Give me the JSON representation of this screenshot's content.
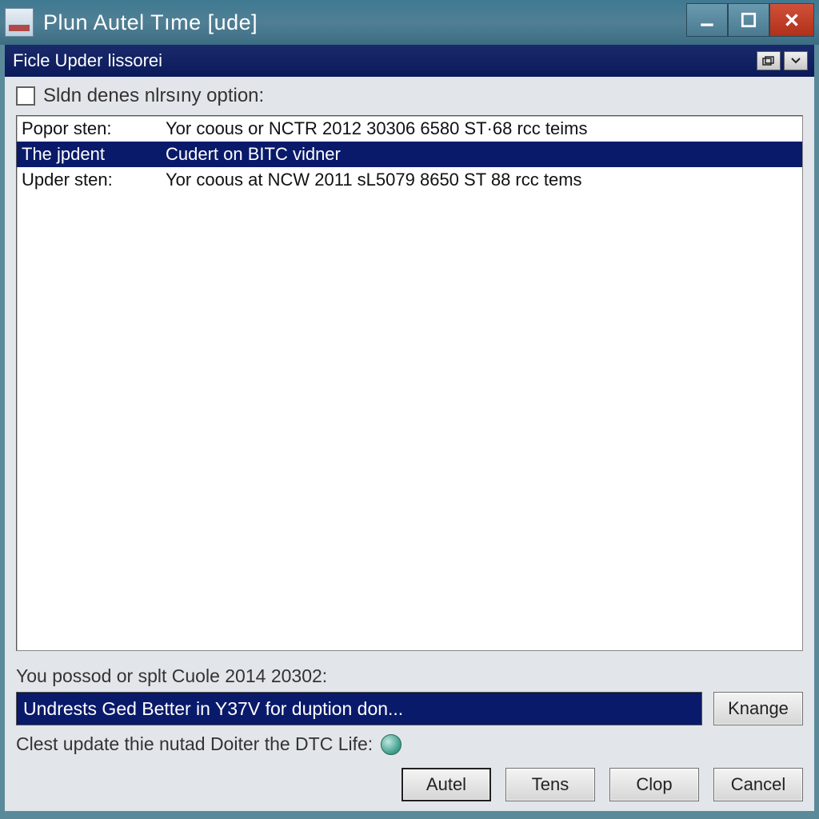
{
  "window": {
    "title": "Plun Autel Tıme [ude]"
  },
  "subheader": {
    "title": "Ficle Upder lissorei"
  },
  "body": {
    "checkbox_label": "Sldn denes nlrsıny option:",
    "list": {
      "rows": [
        {
          "label": "Popor sten:",
          "value": "Yor coous or NCTR 2012 30306 6580 ST·68 rcc teims",
          "selected": false
        },
        {
          "label": "The jpdent",
          "value": "Cudert on BITC vidner",
          "selected": true
        },
        {
          "label": "Upder sten:",
          "value": "Yor coous at NCW 2011 sL5079 8650 ST 88 rcc tems",
          "selected": false
        }
      ]
    },
    "status_line": "You possod or splt Cuole 2014 20302:",
    "path_value": "Undrests Ged Better in Y37V for duption don...",
    "knange_button": "Knange",
    "clest_line": "Clest update thie nutad Doiter the DTC Life:",
    "buttons": {
      "autel": "Autel",
      "tens": "Tens",
      "clop": "Clop",
      "cancel": "Cancel"
    }
  }
}
